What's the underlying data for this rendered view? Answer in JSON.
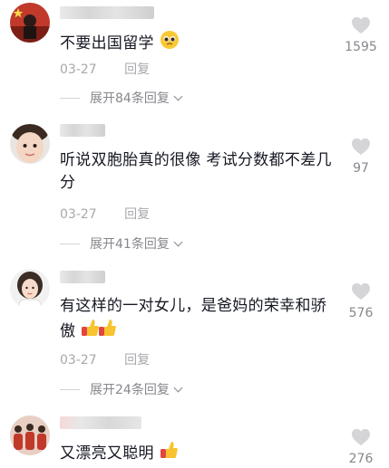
{
  "comments": [
    {
      "text": "不要出国留学",
      "date": "03-27",
      "reply_label": "回复",
      "expand_label": "展开84条回复",
      "likes": "1595"
    },
    {
      "text": "听说双胞胎真的很像 考试分数都不差几分",
      "date": "03-27",
      "reply_label": "回复",
      "expand_label": "展开41条回复",
      "likes": "97"
    },
    {
      "text": "有这样的一对女儿，是爸妈的荣幸和骄傲",
      "date": "03-27",
      "reply_label": "回复",
      "expand_label": "展开24条回复",
      "likes": "576"
    },
    {
      "text": "又漂亮又聪明",
      "likes": "276"
    }
  ],
  "icons": {
    "like": "heart-icon",
    "expand": "chevron-down-icon"
  },
  "colors": {
    "text": "#161823",
    "meta": "#a8a8ad",
    "heart": "#d5d5d8"
  }
}
